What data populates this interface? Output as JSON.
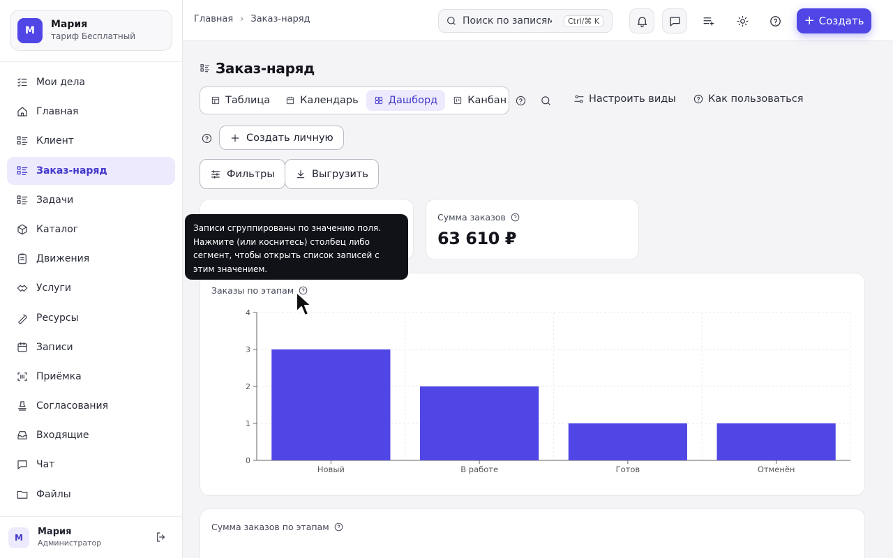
{
  "sidebar": {
    "user": {
      "initial": "М",
      "name": "Мария",
      "plan": "тариф Бесплатный"
    },
    "items": [
      {
        "label": "Мои дела",
        "icon": "checklist-icon"
      },
      {
        "label": "Главная",
        "icon": "home-icon"
      },
      {
        "label": "Клиент",
        "icon": "list-icon"
      },
      {
        "label": "Заказ-наряд",
        "icon": "list-icon",
        "active": true
      },
      {
        "label": "Задачи",
        "icon": "list-icon"
      },
      {
        "label": "Каталог",
        "icon": "box-icon"
      },
      {
        "label": "Движения",
        "icon": "clipboard-icon"
      },
      {
        "label": "Услуги",
        "icon": "handshake-icon"
      },
      {
        "label": "Ресурсы",
        "icon": "wrench-icon"
      },
      {
        "label": "Записи",
        "icon": "calendar-icon"
      },
      {
        "label": "Приёмка",
        "icon": "scan-icon"
      },
      {
        "label": "Согласования",
        "icon": "stamp-icon"
      },
      {
        "label": "Входящие",
        "icon": "inbox-icon"
      },
      {
        "label": "Чат",
        "icon": "chat-icon"
      },
      {
        "label": "Файлы",
        "icon": "folder-icon"
      }
    ],
    "footer": {
      "initial": "М",
      "name": "Мария",
      "role": "Администратор"
    }
  },
  "topbar": {
    "breadcrumb": [
      "Главная",
      "Заказ-наряд"
    ],
    "search_placeholder": "Поиск по записям",
    "search_shortcut": "Ctrl/⌘ K",
    "create_label": "Создать"
  },
  "page": {
    "title": "Заказ-наряд",
    "views": [
      {
        "label": "Таблица",
        "icon": "table-icon"
      },
      {
        "label": "Календарь",
        "icon": "calendar-icon"
      },
      {
        "label": "Дашборд",
        "icon": "dashboard-icon",
        "active": true
      },
      {
        "label": "Канбан",
        "icon": "kanban-icon"
      }
    ],
    "configure_views": "Настроить виды",
    "how_to_use": "Как пользоваться",
    "create_personal": "Создать личную",
    "filters": "Фильтры",
    "export": "Выгрузить"
  },
  "stats": {
    "sum_label": "Сумма заказов",
    "sum_value": "63 610 ₽"
  },
  "tooltip": {
    "text": "Записи сгруппированы по значению поля. Нажмите (или коснитесь) столбец либо сегмент, чтобы открыть список записей с этим значением."
  },
  "chart_data": [
    {
      "type": "bar",
      "title": "Заказы по этапам",
      "categories": [
        "Новый",
        "В работе",
        "Готов",
        "Отменён"
      ],
      "values": [
        3,
        2,
        1,
        1
      ],
      "ylim": [
        0,
        4
      ],
      "yticks": [
        0,
        1,
        2,
        3,
        4
      ],
      "grid": true,
      "color": "#5046e5"
    }
  ],
  "second_chart_title": "Сумма заказов по этапам",
  "colors": {
    "accent": "#4f46e5",
    "bar": "#5046e5"
  }
}
